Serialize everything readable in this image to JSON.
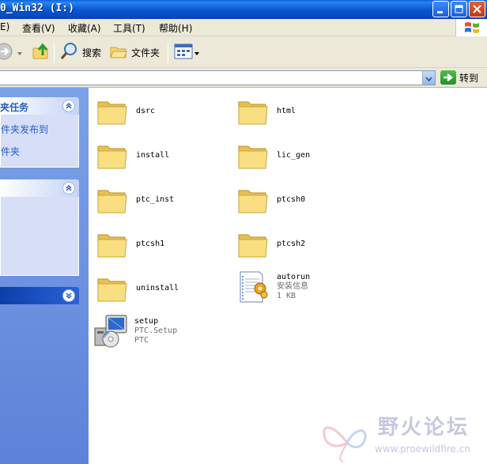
{
  "window": {
    "title": "0_Win32 (I:)",
    "icons": [
      "minimize-icon",
      "maximize-icon",
      "close-icon"
    ]
  },
  "menu": {
    "items": [
      "E)",
      "查看(V)",
      "收藏(A)",
      "工具(T)",
      "帮助(H)"
    ]
  },
  "toolbar": {
    "search_label": "搜索",
    "folders_label": "文件夹"
  },
  "address": {
    "value": "",
    "go_label": "转到"
  },
  "taskpane": {
    "panel1_title": "夹任务",
    "panel1_links": [
      "件夹发布到",
      "件夹"
    ],
    "panel2_title": "",
    "panel3_title": ""
  },
  "files": [
    {
      "name": "dsrc",
      "type": "folder"
    },
    {
      "name": "html",
      "type": "folder"
    },
    {
      "name": "install",
      "type": "folder"
    },
    {
      "name": "lic_gen",
      "type": "folder"
    },
    {
      "name": "ptc_inst",
      "type": "folder"
    },
    {
      "name": "ptcsh0",
      "type": "folder"
    },
    {
      "name": "ptcsh1",
      "type": "folder"
    },
    {
      "name": "ptcsh2",
      "type": "folder"
    },
    {
      "name": "uninstall",
      "type": "folder"
    },
    {
      "name": "autorun",
      "type": "setup-info",
      "line2": "安装信息",
      "line3": "1 KB"
    },
    {
      "name": "setup",
      "type": "installer",
      "line2": "PTC.Setup",
      "line3": "PTC"
    }
  ],
  "watermark": {
    "text": "野火论坛",
    "url": "www.proewildfire.cn"
  },
  "colors": {
    "titlebar": "#0a58d0",
    "taskpane": "#6a8fdf",
    "task_link": "#215dc6",
    "folder": "#f5d66e"
  }
}
